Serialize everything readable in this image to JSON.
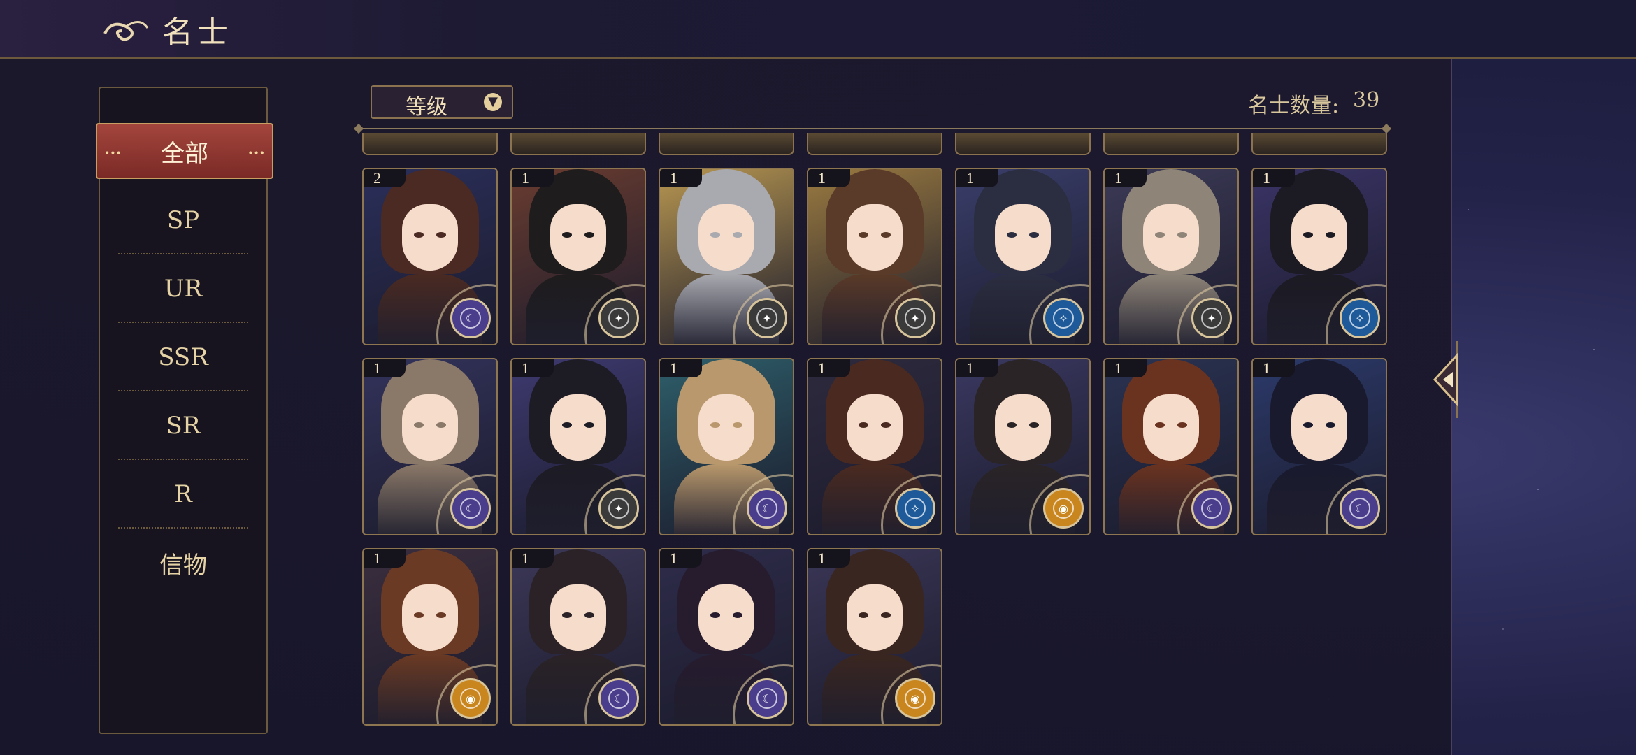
{
  "header": {
    "title": "名士"
  },
  "tabs": [
    {
      "label": "全部",
      "active": true
    },
    {
      "label": "SP"
    },
    {
      "label": "UR"
    },
    {
      "label": "SSR"
    },
    {
      "label": "SR"
    },
    {
      "label": "R"
    },
    {
      "label": "信物"
    }
  ],
  "sort": {
    "label": "等级"
  },
  "count": {
    "label": "名士数量:",
    "value": "39"
  },
  "colors": {
    "purple_badge": "#4a3d8c",
    "dark_badge": "#3a3a3a",
    "blue_badge": "#1e5a99",
    "gold_badge": "#c9861f",
    "card_gold": "#b7955a"
  },
  "cards": [
    {
      "level": "2",
      "badge": "purple",
      "hair": "#4a2a22",
      "bg": "#2b2f5a"
    },
    {
      "level": "1",
      "badge": "dark",
      "hair": "#1e1c1c",
      "bg": "#6a3c30"
    },
    {
      "level": "1",
      "badge": "dark",
      "hair": "#a9a9b0",
      "bg": "#b79650"
    },
    {
      "level": "1",
      "badge": "dark",
      "hair": "#5a3a28",
      "bg": "#9a7a40"
    },
    {
      "level": "1",
      "badge": "blue",
      "hair": "#2b2e40",
      "bg": "#3a3e6a"
    },
    {
      "level": "1",
      "badge": "dark",
      "hair": "#8e8478",
      "bg": "#3c3a56"
    },
    {
      "level": "1",
      "badge": "blue",
      "hair": "#1c1a22",
      "bg": "#3a3466"
    },
    {
      "level": "1",
      "badge": "purple",
      "hair": "#8a7868",
      "bg": "#33335c"
    },
    {
      "level": "1",
      "badge": "dark",
      "hair": "#1d1b24",
      "bg": "#3e3a70"
    },
    {
      "level": "1",
      "badge": "purple",
      "hair": "#b8986c",
      "bg": "#2e5e6a"
    },
    {
      "level": "1",
      "badge": "blue",
      "hair": "#4a2a20",
      "bg": "#2e2a3e"
    },
    {
      "level": "1",
      "badge": "gold",
      "hair": "#2a2426",
      "bg": "#3a3860"
    },
    {
      "level": "1",
      "badge": "purple",
      "hair": "#6a3320",
      "bg": "#2a3352"
    },
    {
      "level": "1",
      "badge": "purple",
      "hair": "#1a1a2e",
      "bg": "#2c3a6a"
    },
    {
      "level": "1",
      "badge": "gold",
      "hair": "#6a3a24",
      "bg": "#3a2e3e"
    },
    {
      "level": "1",
      "badge": "purple",
      "hair": "#2a2226",
      "bg": "#3c3858"
    },
    {
      "level": "1",
      "badge": "purple",
      "hair": "#261c2e",
      "bg": "#2e2c4a"
    },
    {
      "level": "1",
      "badge": "gold",
      "hair": "#3a2620",
      "bg": "#3a3656"
    }
  ]
}
